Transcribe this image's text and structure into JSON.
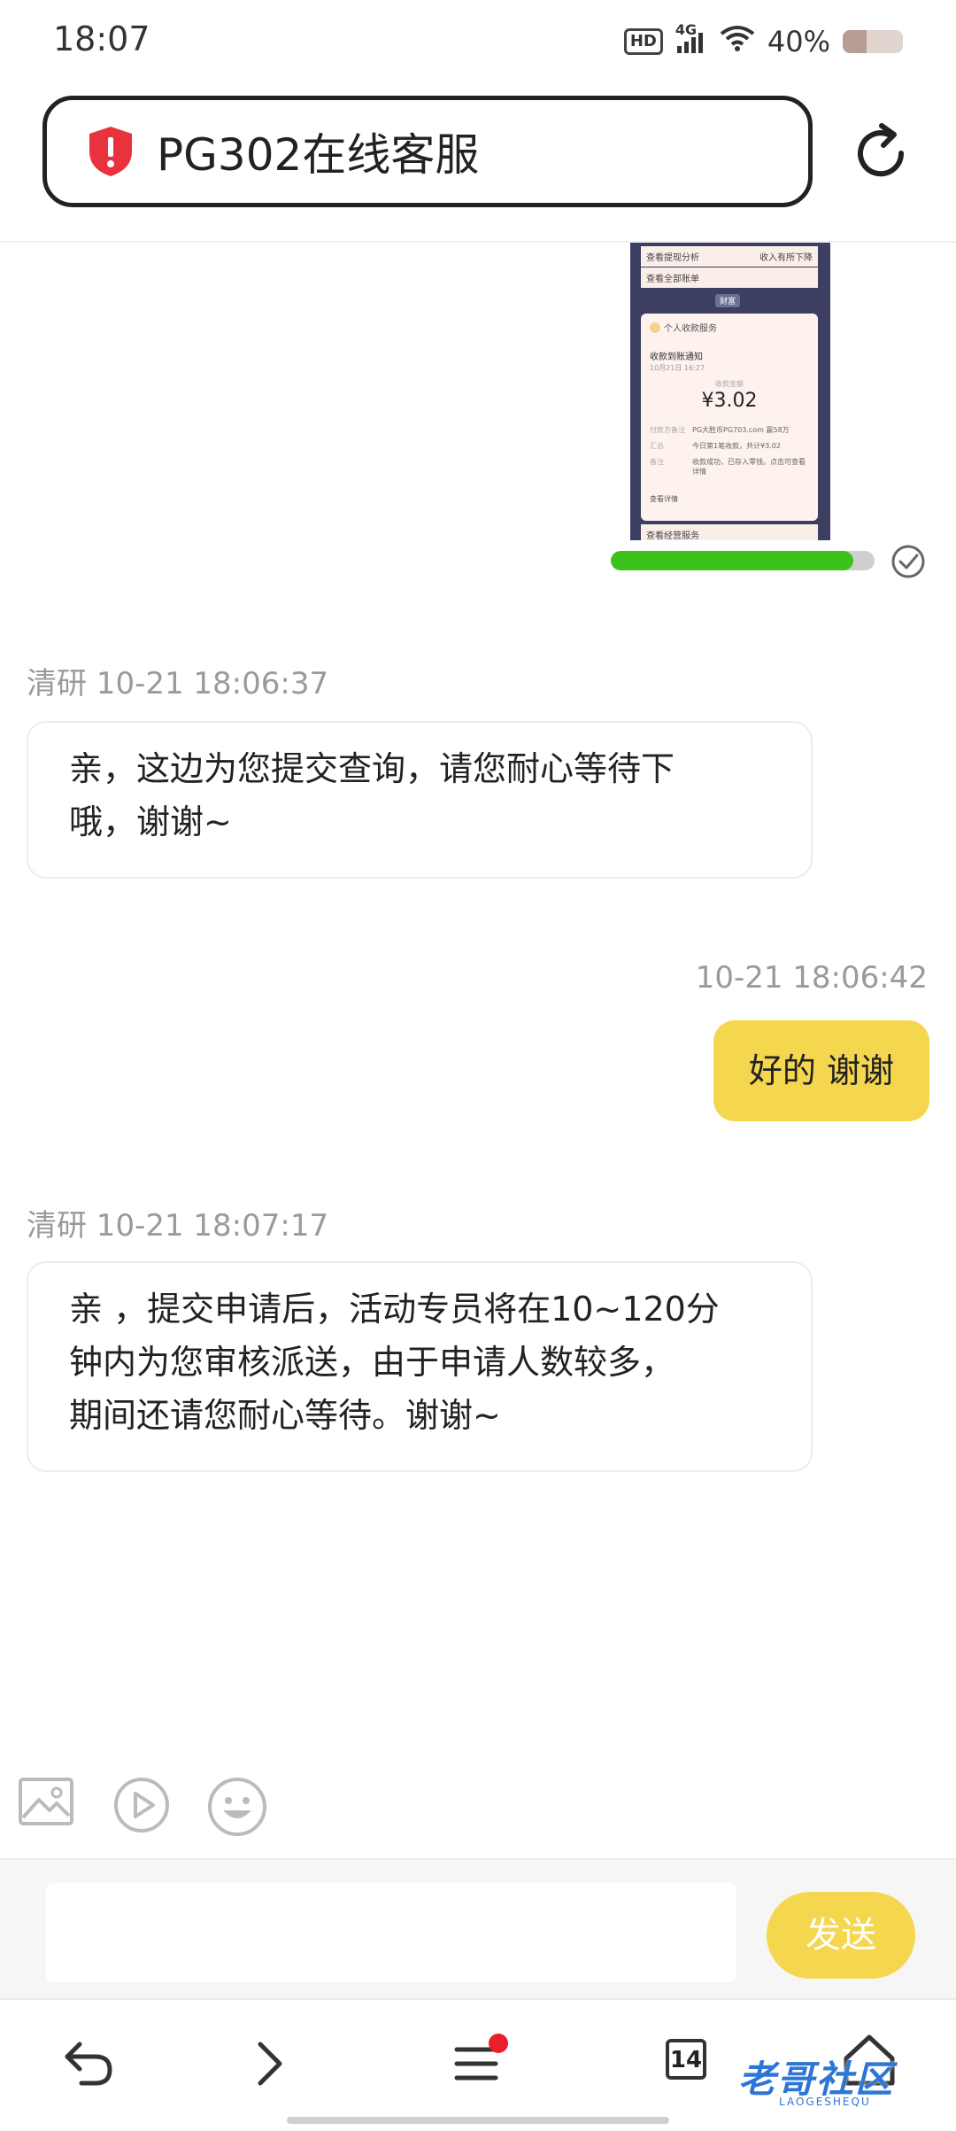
{
  "status_bar": {
    "time": "18:07",
    "hd_label": "HD",
    "network": "4G",
    "battery_percent": "40%",
    "battery_level": 0.4
  },
  "url_bar": {
    "title": "PG302在线客服",
    "security_icon": "shield-warning-icon",
    "reload_icon": "reload-icon"
  },
  "chat": {
    "image_message": {
      "row1_left": "查看提现分析",
      "row1_right": "收入有所下降",
      "row2_left": "查看全部账单",
      "badge": "财富",
      "card_title": "个人收款服务",
      "notice": "收款到账通知",
      "date": "10月21日 16:27",
      "amount_label": "收款金额",
      "amount": "¥3.02",
      "payer_label": "付款方备注",
      "payer_value": "PG大胜币PG703.com 赢58万",
      "summary_label": "汇总",
      "summary_value": "今日第1笔收款，共计¥3.02",
      "note_label": "备注",
      "note_value": "收款成功，已存入零钱。点击可查看详情",
      "link1": "查看详情",
      "link2": "查看经营服务",
      "upload_progress": 0.92,
      "status_icon": "check-circle-icon"
    },
    "messages": [
      {
        "sender_line": "清研 10-21 18:06:37",
        "text_line1": "亲，这边为您提交查询，请您耐心等待下",
        "text_line2": "哦，谢谢~"
      },
      {
        "time": "10-21 18:06:42",
        "text": "好的 谢谢"
      },
      {
        "sender_line": "清研 10-21 18:07:17",
        "text_line1": "亲 ，提交申请后，活动专员将在10~120分",
        "text_line2": "钟内为您审核派送，由于申请人数较多，",
        "text_line3": "期间还请您耐心等待。谢谢~"
      }
    ]
  },
  "toolbar": {
    "icons": [
      "image-icon",
      "video-play-icon",
      "emoji-icon"
    ]
  },
  "input": {
    "value": "",
    "placeholder": "",
    "send_label": "发送"
  },
  "bottom_nav": {
    "icons": [
      "back-icon",
      "forward-icon",
      "menu-icon",
      "tabs-icon",
      "home-icon"
    ],
    "tab_count": "14",
    "watermark": "老哥社区",
    "watermark_sub": "LAOGESHEQU"
  },
  "colors": {
    "accent_yellow": "#f5d64f",
    "progress_green": "#3cc21b",
    "shield_red": "#e8323c",
    "notify_red": "#e8202b"
  }
}
